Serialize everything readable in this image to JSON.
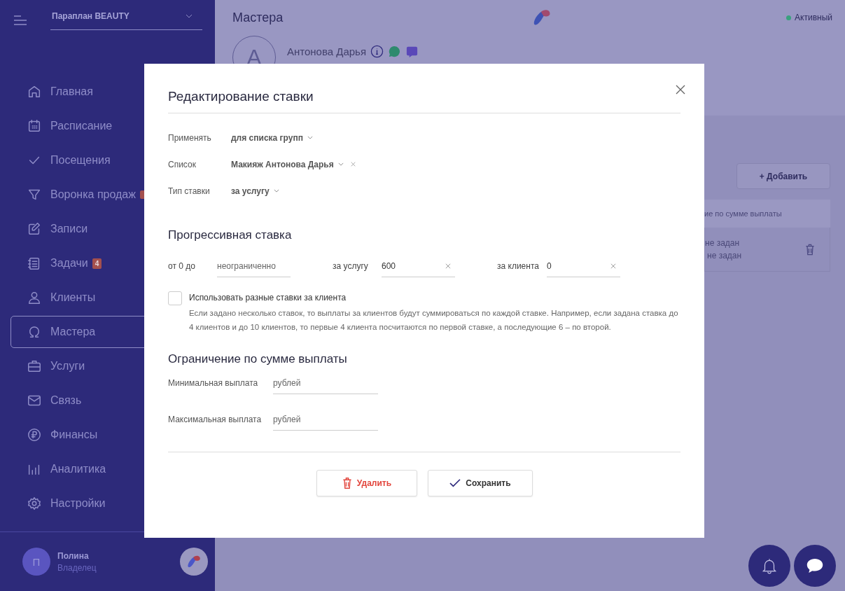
{
  "sidebar": {
    "org": "Параплан BEAUTY",
    "items": [
      {
        "label": "Главная",
        "selected": false
      },
      {
        "label": "Расписание",
        "selected": false
      },
      {
        "label": "Посещения",
        "selected": false
      },
      {
        "label": "Воронка продаж",
        "selected": false,
        "badge_hidden": true
      },
      {
        "label": "Записи",
        "selected": false
      },
      {
        "label": "Задачи",
        "selected": false,
        "badge": "4"
      },
      {
        "label": "Клиенты",
        "selected": false
      },
      {
        "label": "Мастера",
        "selected": true
      },
      {
        "label": "Услуги",
        "selected": false
      },
      {
        "label": "Связь",
        "selected": false
      },
      {
        "label": "Финансы",
        "selected": false
      },
      {
        "label": "Аналитика",
        "selected": false
      },
      {
        "label": "Настройки",
        "selected": false
      }
    ],
    "user": {
      "initial": "П",
      "name": "Полина",
      "role": "Владелец"
    }
  },
  "page": {
    "title": "Мастера",
    "status": {
      "label": "Активный",
      "color": "#3aa17e"
    },
    "master": {
      "initial": "А",
      "name": "Антонова Дарья"
    },
    "add_button": "+ Добавить",
    "table": {
      "header": "ие по сумме выплаты",
      "cells": [
        "не задан",
        "не задан"
      ]
    }
  },
  "modal": {
    "title": "Редактирование ставки",
    "fields": [
      {
        "label": "Применять",
        "value": "для списка групп",
        "clearable": false
      },
      {
        "label": "Список",
        "value": "Макияж Антонова Дарья",
        "clearable": true
      },
      {
        "label": "Тип ставки",
        "value": "за услугу",
        "clearable": false
      }
    ],
    "progressive": {
      "heading": "Прогрессивная ставка",
      "from_label": "от 0 до",
      "limit_placeholder": "неограниченно",
      "per_service_label": "за услугу",
      "per_service_value": "600",
      "per_client_label": "за клиента",
      "per_client_value": "0"
    },
    "different_rates": {
      "label": "Использовать разные ставки за клиента",
      "checked": false,
      "description": "Если задано несколько ставок, то выплаты за клиентов будут суммироваться по каждой ставке. Например, если задана ставка до 4 клиентов и до 10 клиентов, то первые 4 клиента посчитаются по первой ставке, а последующие 6 – по второй."
    },
    "limit": {
      "heading": "Ограничение по сумме выплаты",
      "rows": [
        {
          "label": "Минимальная выплата",
          "placeholder": "рублей"
        },
        {
          "label": "Максимальная выплата",
          "placeholder": "рублей"
        }
      ]
    },
    "buttons": {
      "delete": "Удалить",
      "save": "Сохранить"
    }
  }
}
